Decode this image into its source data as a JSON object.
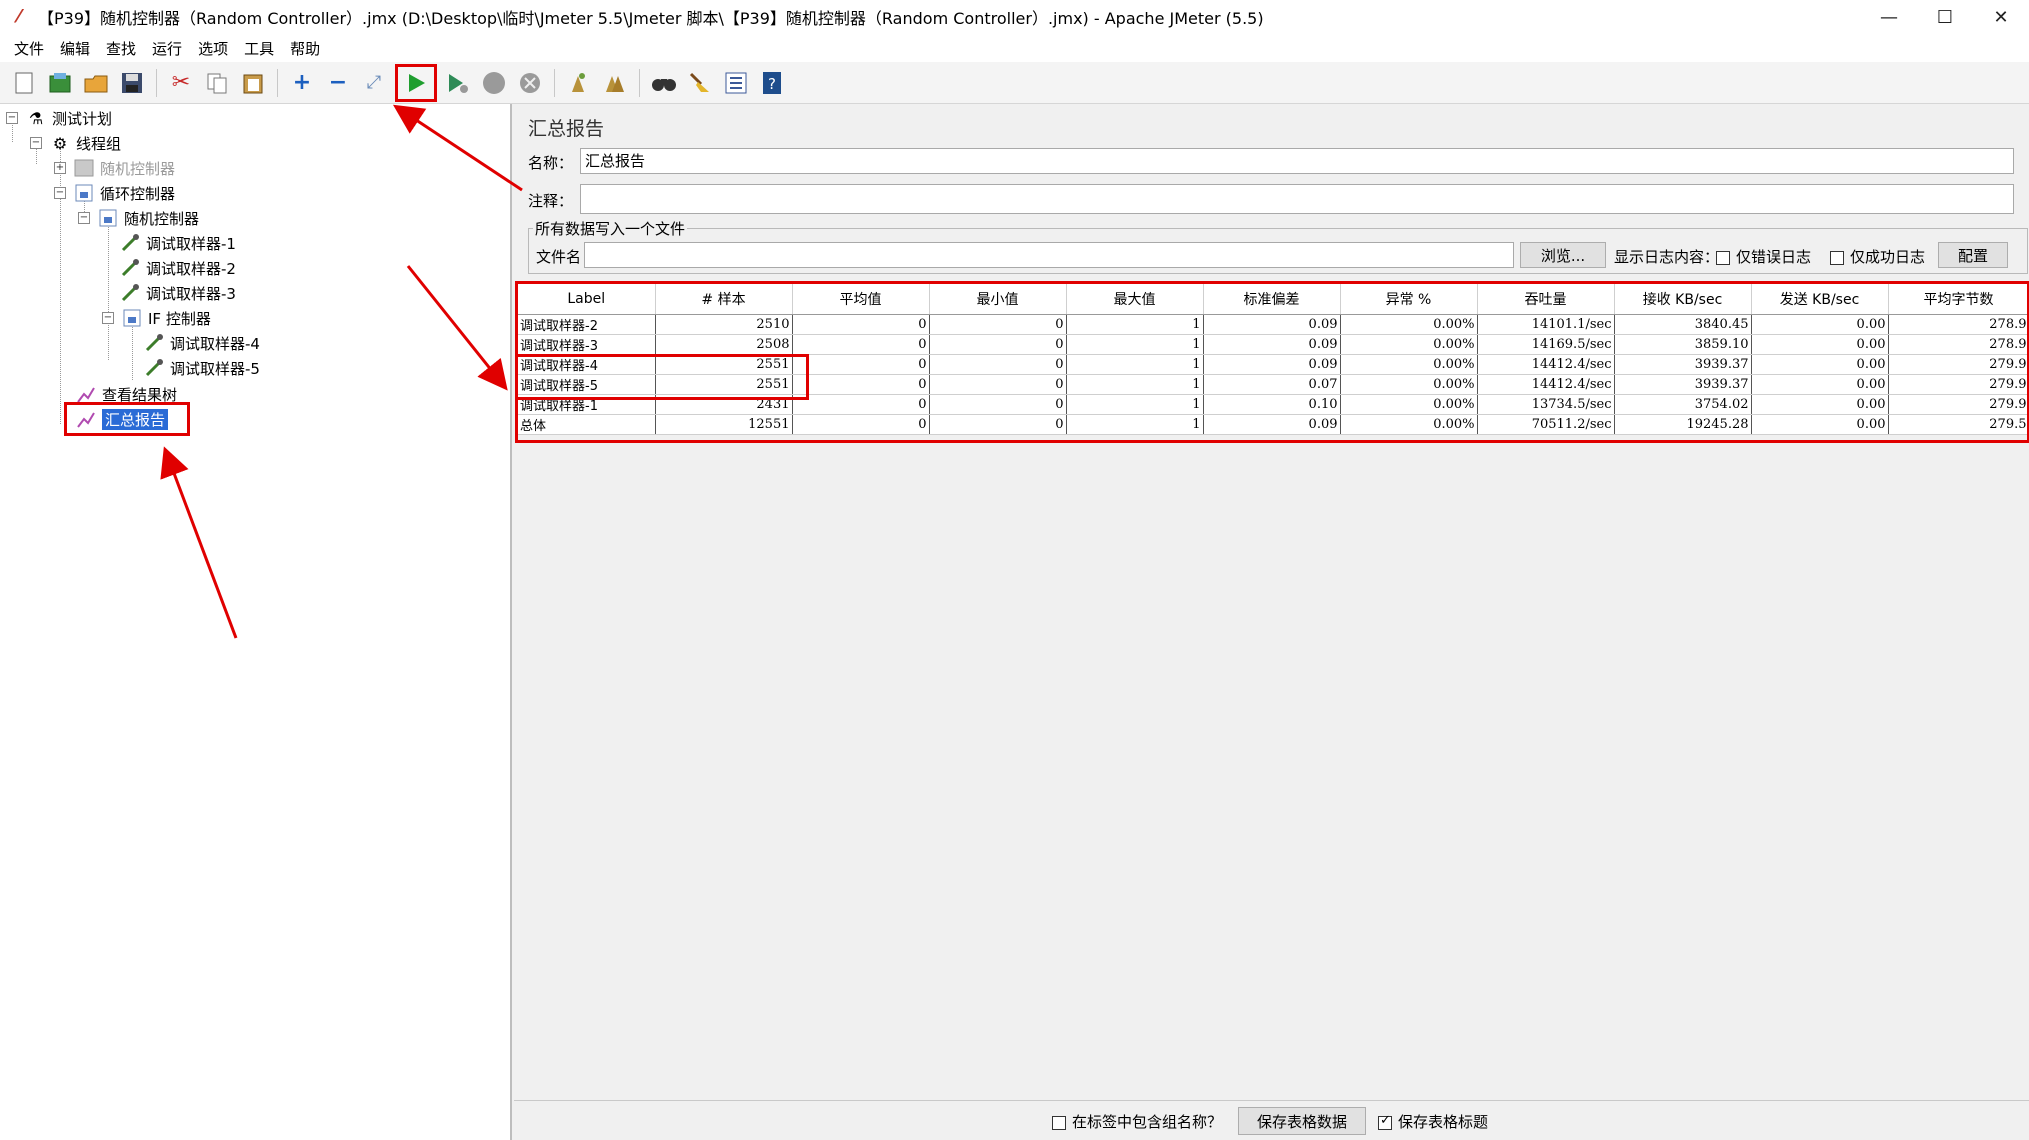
{
  "window": {
    "title": "【P39】随机控制器（Random Controller）.jmx (D:\\Desktop\\临时\\Jmeter 5.5\\Jmeter 脚本\\【P39】随机控制器（Random Controller）.jmx) - Apache JMeter (5.5)",
    "minimize": "—",
    "maximize": "☐",
    "close": "✕"
  },
  "menu": [
    "文件",
    "编辑",
    "查找",
    "运行",
    "选项",
    "工具",
    "帮助"
  ],
  "tree": {
    "test_plan": "测试计划",
    "thread_group": "线程组",
    "random_controller_disabled": "随机控制器",
    "loop_controller": "循环控制器",
    "random_controller": "随机控制器",
    "sampler1": "调试取样器-1",
    "sampler2": "调试取样器-2",
    "sampler3": "调试取样器-3",
    "if_controller": "IF 控制器",
    "sampler4": "调试取样器-4",
    "sampler5": "调试取样器-5",
    "view_results_tree": "查看结果树",
    "summary_report": "汇总报告"
  },
  "panel": {
    "title": "汇总报告",
    "name_label": "名称：",
    "name_value": "汇总报告",
    "comment_label": "注释：",
    "comment_value": "",
    "file_group_legend": "所有数据写入一个文件",
    "filename_label": "文件名",
    "filename_value": "",
    "browse_button": "浏览...",
    "log_content_label": "显示日志内容：",
    "errors_only": "仅错误日志",
    "success_only": "仅成功日志",
    "configure_button": "配置"
  },
  "table": {
    "headers": [
      "Label",
      "# 样本",
      "平均值",
      "最小值",
      "最大值",
      "标准偏差",
      "异常 %",
      "吞吐量",
      "接收 KB/sec",
      "发送 KB/sec",
      "平均字节数"
    ],
    "rows": [
      [
        "调试取样器-2",
        "2510",
        "0",
        "0",
        "1",
        "0.09",
        "0.00%",
        "14101.1/sec",
        "3840.45",
        "0.00",
        "278.9"
      ],
      [
        "调试取样器-3",
        "2508",
        "0",
        "0",
        "1",
        "0.09",
        "0.00%",
        "14169.5/sec",
        "3859.10",
        "0.00",
        "278.9"
      ],
      [
        "调试取样器-4",
        "2551",
        "0",
        "0",
        "1",
        "0.09",
        "0.00%",
        "14412.4/sec",
        "3939.37",
        "0.00",
        "279.9"
      ],
      [
        "调试取样器-5",
        "2551",
        "0",
        "0",
        "1",
        "0.07",
        "0.00%",
        "14412.4/sec",
        "3939.37",
        "0.00",
        "279.9"
      ],
      [
        "调试取样器-1",
        "2431",
        "0",
        "0",
        "1",
        "0.10",
        "0.00%",
        "13734.5/sec",
        "3754.02",
        "0.00",
        "279.9"
      ],
      [
        "总体",
        "12551",
        "0",
        "0",
        "1",
        "0.09",
        "0.00%",
        "70511.2/sec",
        "19245.28",
        "0.00",
        "279.5"
      ]
    ]
  },
  "bottom": {
    "include_group_name": "在标签中包含组名称？",
    "save_table_data": "保存表格数据",
    "save_table_header": "保存表格标题"
  },
  "colors": {
    "annotation_red": "#e00000",
    "selection_blue": "#2a6bd6",
    "run_green": "#1f9e2f"
  }
}
